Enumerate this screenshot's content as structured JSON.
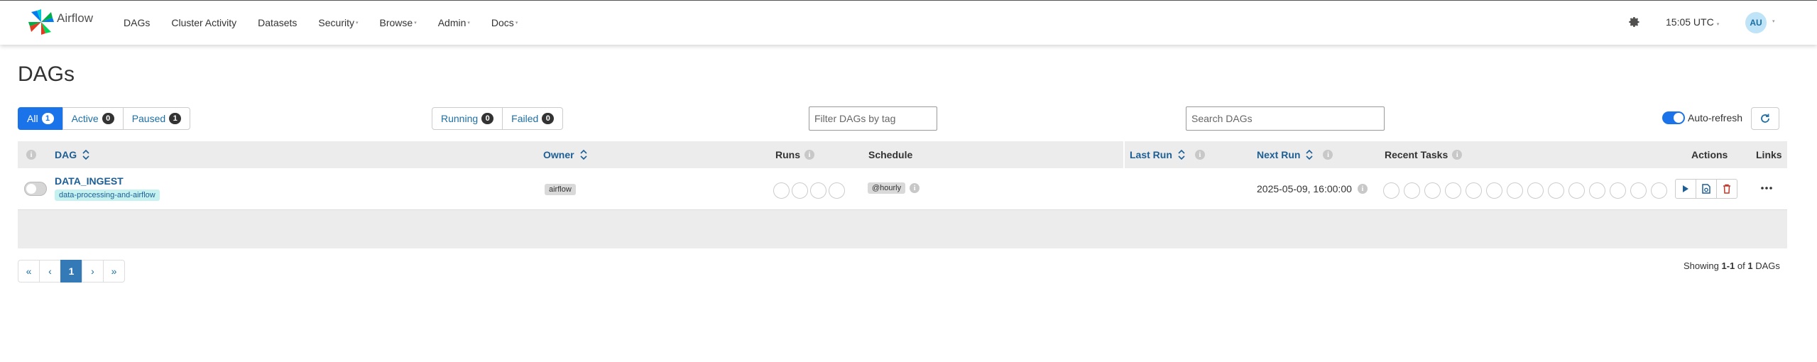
{
  "brand": {
    "name": "Airflow"
  },
  "nav": {
    "items": [
      {
        "label": "DAGs",
        "dropdown": false
      },
      {
        "label": "Cluster Activity",
        "dropdown": false
      },
      {
        "label": "Datasets",
        "dropdown": false
      },
      {
        "label": "Security",
        "dropdown": true
      },
      {
        "label": "Browse",
        "dropdown": true
      },
      {
        "label": "Admin",
        "dropdown": true
      },
      {
        "label": "Docs",
        "dropdown": true
      }
    ],
    "time": "15:05 UTC",
    "user_initials": "AU"
  },
  "page": {
    "title": "DAGs"
  },
  "filters": {
    "status_tabs": [
      {
        "label": "All",
        "count": "1",
        "active": true
      },
      {
        "label": "Active",
        "count": "0",
        "active": false
      },
      {
        "label": "Paused",
        "count": "1",
        "active": false
      }
    ],
    "run_tabs": [
      {
        "label": "Running",
        "count": "0"
      },
      {
        "label": "Failed",
        "count": "0"
      }
    ],
    "tag_placeholder": "Filter DAGs by tag",
    "search_placeholder": "Search DAGs",
    "auto_refresh_label": "Auto-refresh",
    "auto_refresh_on": true
  },
  "table": {
    "headers": {
      "dag": "DAG",
      "owner": "Owner",
      "runs": "Runs",
      "schedule": "Schedule",
      "last_run": "Last Run",
      "next_run": "Next Run",
      "recent_tasks": "Recent Tasks",
      "actions": "Actions",
      "links": "Links"
    },
    "rows": [
      {
        "dag_id": "DATA_INGEST",
        "tag": "data-processing-and-airflow",
        "owner": "airflow",
        "schedule": "@hourly",
        "last_run": "",
        "next_run": "2025-05-09, 16:00:00",
        "paused": true,
        "runs_circles": 4,
        "task_circles": 14
      }
    ]
  },
  "pagination": {
    "first": "«",
    "prev": "‹",
    "current": "1",
    "next": "›",
    "last": "»"
  },
  "summary": {
    "prefix": "Showing",
    "range": "1-1",
    "of": "of",
    "total": "1",
    "suffix": "DAGs"
  },
  "colors": {
    "primary": "#1a73e8",
    "link": "#1d5f95",
    "tag_bg": "#c5f2f0",
    "delete": "#c0392b"
  }
}
